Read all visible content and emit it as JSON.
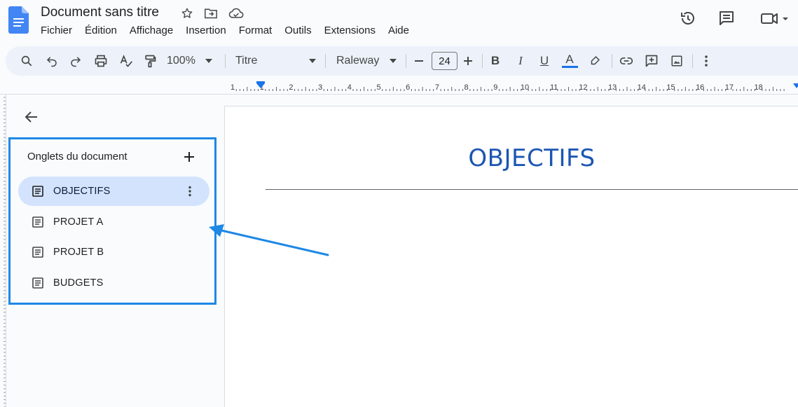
{
  "app": {
    "title": "Document sans titre",
    "menu": [
      "Fichier",
      "Édition",
      "Affichage",
      "Insertion",
      "Format",
      "Outils",
      "Extensions",
      "Aide"
    ]
  },
  "toolbar": {
    "zoom": "100%",
    "style": "Titre",
    "font": "Raleway",
    "font_size": "24"
  },
  "ruler": {
    "marks": [
      "1",
      "1",
      "2",
      "3",
      "4",
      "5",
      "6",
      "7",
      "8",
      "9",
      "10",
      "11",
      "12",
      "13",
      "14",
      "15",
      "16",
      "17",
      "18"
    ]
  },
  "sidebar": {
    "panel_title": "Onglets du document",
    "tabs": [
      {
        "label": "OBJECTIFS",
        "active": true
      },
      {
        "label": "PROJET A",
        "active": false
      },
      {
        "label": "PROJET B",
        "active": false
      },
      {
        "label": "BUDGETS",
        "active": false
      }
    ]
  },
  "document": {
    "heading": "OBJECTIFS"
  },
  "colors": {
    "accent": "#1a73e8",
    "heading": "#1c56b2",
    "active_tab": "#d3e3fd",
    "annotation": "#1e88e5"
  }
}
